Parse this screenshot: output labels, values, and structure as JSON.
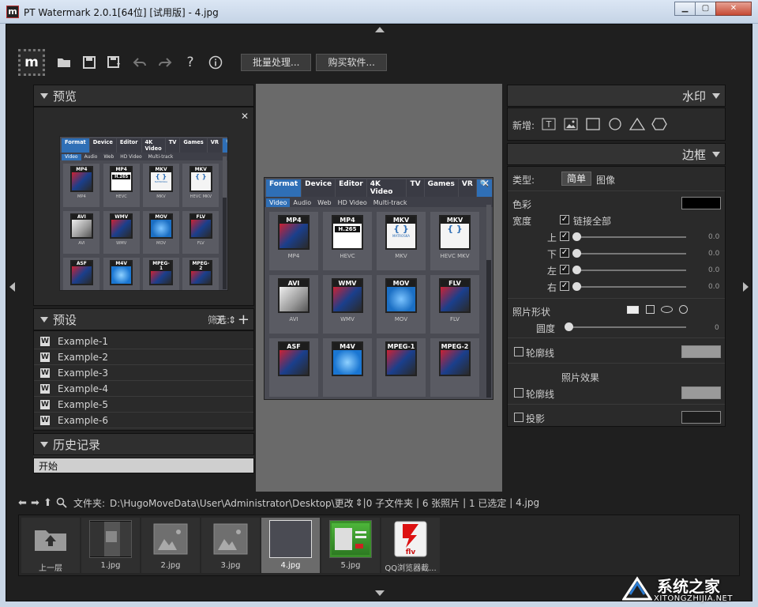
{
  "window": {
    "title": "PT Watermark 2.0.1[64位] [试用版] - 4.jpg",
    "controls": [
      "minimize",
      "maximize",
      "close"
    ]
  },
  "toolbar": {
    "logo_letter": "m",
    "icons": [
      "open-folder-icon",
      "save-icon",
      "save-as-icon",
      "undo-icon",
      "redo-icon",
      "help-icon",
      "info-icon"
    ],
    "batch_label": "批量处理...",
    "buy_label": "购买软件..."
  },
  "preview_panel": {
    "title": "预览"
  },
  "presets_panel": {
    "title": "预设",
    "filter_label": "筛选:",
    "filter_value": "无",
    "items": [
      "Example-1",
      "Example-2",
      "Example-3",
      "Example-4",
      "Example-5",
      "Example-6"
    ]
  },
  "history_panel": {
    "title": "历史记录",
    "items": [
      "开始"
    ]
  },
  "image_content": {
    "tabs": [
      "Format",
      "Device",
      "Editor",
      "4K Video",
      "TV",
      "Games",
      "VR"
    ],
    "active_tab": "Format",
    "subtabs": [
      "Video",
      "Audio",
      "Web",
      "HD Video",
      "Multi-track"
    ],
    "active_subtab": "Video",
    "tiles": [
      {
        "tag": "MP4",
        "caption": "MP4"
      },
      {
        "tag": "MP4",
        "caption": "HEVC"
      },
      {
        "tag": "MKV",
        "caption": "MKV"
      },
      {
        "tag": "MKV",
        "caption": "HEVC MKV"
      },
      {
        "tag": "AVI",
        "caption": "AVI"
      },
      {
        "tag": "WMV",
        "caption": "WMV"
      },
      {
        "tag": "MOV",
        "caption": "MOV"
      },
      {
        "tag": "FLV",
        "caption": "FLV"
      },
      {
        "tag": "ASF",
        "caption": ""
      },
      {
        "tag": "M4V",
        "caption": ""
      },
      {
        "tag": "MPEG-1",
        "caption": ""
      },
      {
        "tag": "MPEG-2",
        "caption": ""
      }
    ],
    "hevc_badge": "H.265",
    "matroska_label": "MATROSKA"
  },
  "watermark_panel": {
    "title": "水印",
    "add_label": "新增:",
    "add_icons": [
      "text-icon",
      "image-icon",
      "rectangle-icon",
      "circle-icon",
      "triangle-icon",
      "hexagon-icon"
    ]
  },
  "border_panel": {
    "title": "边框",
    "type_label": "类型:",
    "type_options": [
      "简单",
      "图像"
    ],
    "type_selected": "简单",
    "color_label": "色彩",
    "color_value": "#000000",
    "width_label": "宽度",
    "link_all_label": "链接全部",
    "sides": [
      {
        "label": "上",
        "value": "0.0"
      },
      {
        "label": "下",
        "value": "0.0"
      },
      {
        "label": "左",
        "value": "0.0"
      },
      {
        "label": "右",
        "value": "0.0"
      }
    ],
    "photo_shape_label": "照片形状",
    "shape_options": [
      "rounded-rect-icon",
      "square-icon",
      "ellipse-icon",
      "circle-icon"
    ],
    "roundness_label": "圆度",
    "roundness_value": "0",
    "outline_label": "轮廓线",
    "outline_color": "#9a9a9a",
    "photo_effects_label": "照片效果",
    "effect_outline_label": "轮廓线",
    "effect_outline_color": "#9a9a9a",
    "shadow_label": "投影",
    "shadow_color": "#1c1c1c"
  },
  "path_bar": {
    "folder_label": "文件夹:",
    "path": "D:\\HugoMoveData\\User\\Administrator\\Desktop\\更改",
    "subfolders": "0 子文件夹",
    "photos": "6 张照片",
    "selected": "1 已选定",
    "current_file": "4.jpg"
  },
  "filmstrip": {
    "items": [
      {
        "name": "上一层",
        "kind": "up-folder-icon",
        "selected": false
      },
      {
        "name": "1.jpg",
        "kind": "screenshot",
        "selected": false
      },
      {
        "name": "2.jpg",
        "kind": "placeholder-image-icon",
        "selected": false
      },
      {
        "name": "3.jpg",
        "kind": "placeholder-image-icon",
        "selected": false
      },
      {
        "name": "4.jpg",
        "kind": "screenshot",
        "selected": true
      },
      {
        "name": "5.jpg",
        "kind": "screenshot-green",
        "selected": false
      },
      {
        "name": "QQ浏览器截...",
        "kind": "flash-flv-icon",
        "selected": false
      }
    ],
    "flv_label": "flv"
  },
  "brand": {
    "name": "系统之家",
    "url": "XITONGZHIJIA.NET"
  }
}
